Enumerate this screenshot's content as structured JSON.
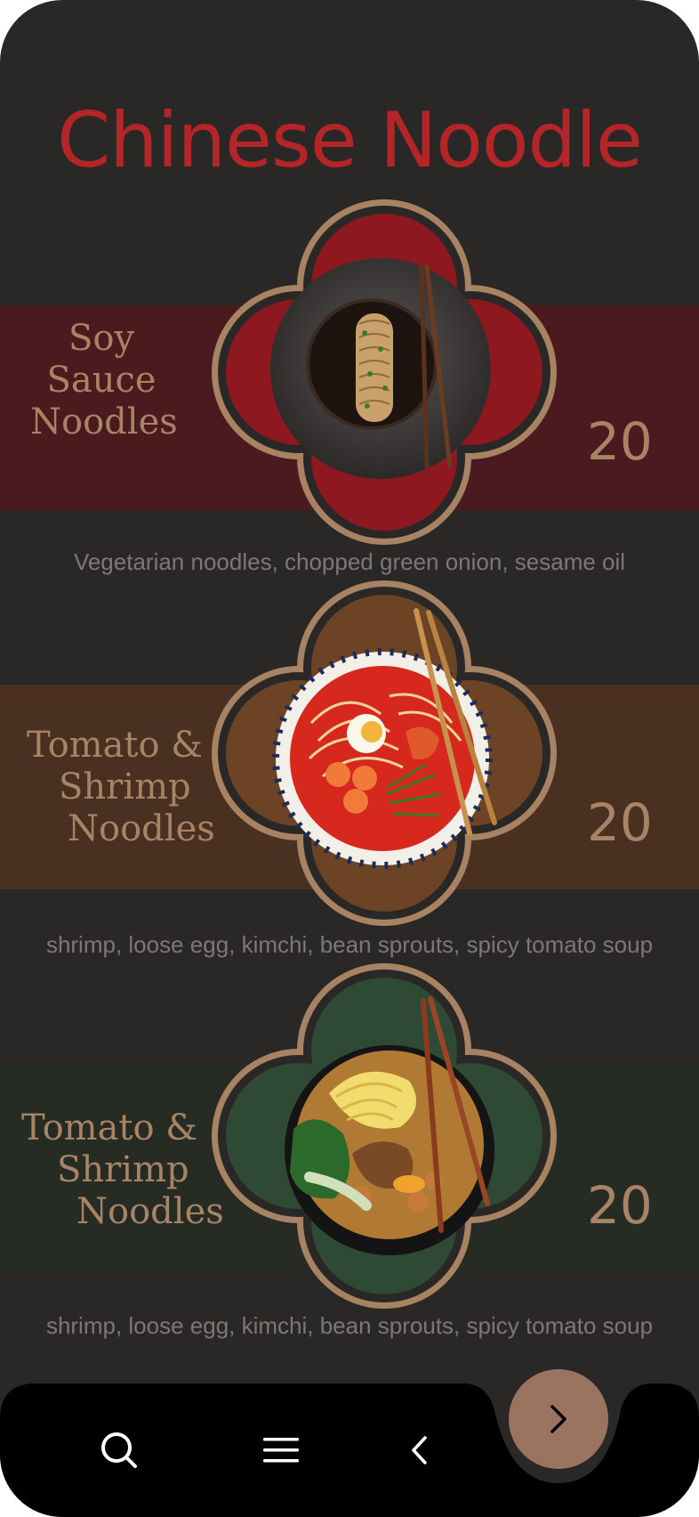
{
  "header": {
    "title": "Chinese Noodle",
    "title_color": "#b42528"
  },
  "colors": {
    "frame": "#a88363",
    "name_text": "#a88466",
    "price_text": "#a88466",
    "fab_bg": "#9b7461",
    "navbar_bg": "#000000"
  },
  "menu": [
    {
      "name_lines": [
        "Soy",
        "Sauce",
        "Noodles"
      ],
      "price": "20",
      "description": "Vegetarian noodles, chopped green onion, sesame oil",
      "band_color": "#4b1a1f",
      "flower_color": "#8e1820",
      "image_icon": "soy-sauce-noodles-bowl"
    },
    {
      "name_lines": [
        "Tomato &",
        "Shrimp",
        "Noodles"
      ],
      "price": "20",
      "description": "shrimp, loose egg, kimchi, bean sprouts, spicy tomato soup",
      "band_color": "#4a3020",
      "flower_color": "#6d4326",
      "image_icon": "tomato-shrimp-noodles-bowl"
    },
    {
      "name_lines": [
        "Tomato &",
        "Shrimp",
        "Noodles"
      ],
      "price": "20",
      "description": "shrimp, loose egg, kimchi, bean sprouts, spicy tomato soup",
      "band_color": "#262b24",
      "flower_color": "#2f4a34",
      "image_icon": "braised-noodles-bowl"
    }
  ],
  "nav": {
    "search_icon": "search-icon",
    "menu_icon": "hamburger-menu-icon",
    "back_icon": "chevron-left-icon",
    "next_icon": "chevron-right-icon"
  }
}
